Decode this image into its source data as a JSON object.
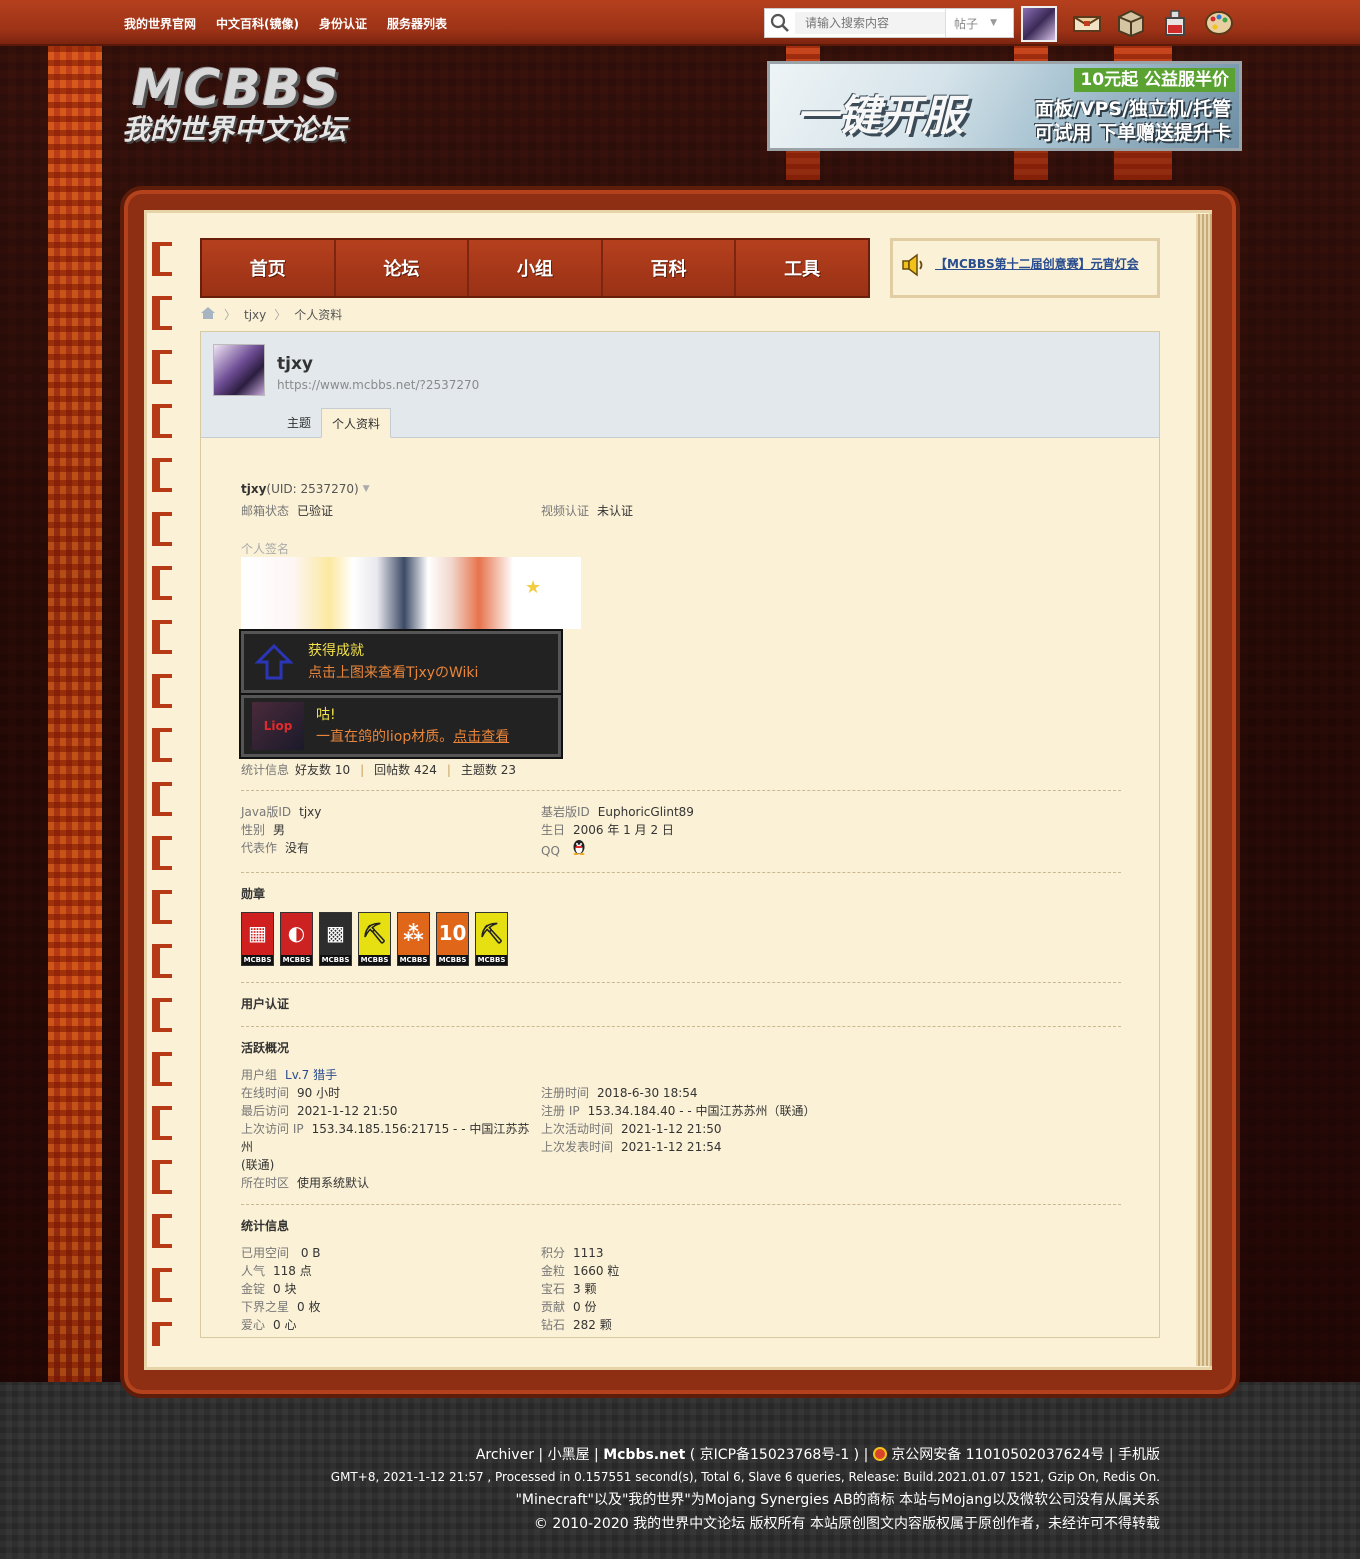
{
  "topbar": {
    "links": [
      "我的世界官网",
      "中文百科(镜像)",
      "身份认证",
      "服务器列表"
    ],
    "search_placeholder": "请输入搜索内容",
    "search_type": "帖子",
    "icons": [
      "avatar",
      "message-icon",
      "inventory-icon",
      "potion-icon",
      "palette-icon"
    ]
  },
  "header": {
    "logo_main": "MCBBS",
    "logo_sub": "我的世界中文论坛",
    "banner": {
      "tag": "10元起 公益服半价",
      "main": "一键开服",
      "line2": "面板/VPS/独立机/托管",
      "line3": "可试用 下单赠送提升卡"
    }
  },
  "nav": {
    "items": [
      "首页",
      "论坛",
      "小组",
      "百科",
      "工具"
    ],
    "notice": "【MCBBS第十二届创意赛】元宵灯会"
  },
  "breadcrumb": {
    "user": "tjxy",
    "page": "个人资料"
  },
  "profile": {
    "username": "tjxy",
    "url": "https://www.mcbbs.net/?2537270",
    "tabs": [
      "主题",
      "个人资料"
    ],
    "active_tab": "个人资料",
    "uid_line_name": "tjxy",
    "uid_line_uid": "(UID: 2537270)",
    "email_label": "邮箱状态",
    "email_value": "已验证",
    "video_label": "视频认证",
    "video_value": "未认证",
    "signature_label": "个人签名",
    "achievement1": {
      "title": "获得成就",
      "sub": "点击上图来查看TjxyのWiki"
    },
    "achievement2": {
      "title": "咕!",
      "sub": "一直在鸽的liop材质。",
      "link": "点击查看"
    },
    "stats_label": "统计信息",
    "stats": [
      "好友数 10",
      "回帖数 424",
      "主题数 23"
    ],
    "info_left": [
      {
        "label": "Java版ID",
        "value": "tjxy"
      },
      {
        "label": "性别",
        "value": "男"
      },
      {
        "label": "代表作",
        "value": "没有"
      }
    ],
    "info_right": [
      {
        "label": "基岩版ID",
        "value": "EuphoricGlint89"
      },
      {
        "label": "生日",
        "value": "2006 年 1 月 2 日"
      },
      {
        "label": "QQ",
        "value": ""
      }
    ],
    "medals_title": "勋章",
    "medals": [
      {
        "color": "#d01f1f",
        "glyph": "▦",
        "tag": "MCBBS"
      },
      {
        "color": "#cc2222",
        "glyph": "◐",
        "tag": "MCBBS"
      },
      {
        "color": "#2d2d2d",
        "glyph": "▩",
        "tag": "MCBBS"
      },
      {
        "color": "#e6e012",
        "glyph": "⛏",
        "tag": "MCBBS"
      },
      {
        "color": "#e0661a",
        "glyph": "⁂",
        "tag": "MCBBS"
      },
      {
        "color": "#e0661a",
        "glyph": "10",
        "tag": "MCBBS"
      },
      {
        "color": "#e6e012",
        "glyph": "⛏",
        "tag": "MCBBS"
      }
    ],
    "auth_title": "用户认证",
    "activity_title": "活跃概况",
    "usergroup_label": "用户组",
    "usergroup_value": "Lv.7 猎手",
    "activity_left": [
      {
        "label": "在线时间",
        "value": "90 小时"
      },
      {
        "label": "最后访问",
        "value": "2021-1-12 21:50"
      },
      {
        "label": "上次访问 IP",
        "value": "153.34.185.156:21715 - - 中国江苏苏州"
      },
      {
        "label": "",
        "value": "(联通)"
      },
      {
        "label": "所在时区",
        "value": "使用系统默认"
      }
    ],
    "activity_right": [
      {
        "label": "注册时间",
        "value": "2018-6-30 18:54"
      },
      {
        "label": "注册 IP",
        "value": "153.34.184.40 - - 中国江苏苏州（联通）"
      },
      {
        "label": "上次活动时间",
        "value": "2021-1-12 21:50"
      },
      {
        "label": "上次发表时间",
        "value": "2021-1-12 21:54"
      }
    ],
    "stats_title": "统计信息",
    "stats_left": [
      {
        "label": "已用空间",
        "value": " 0 B"
      },
      {
        "label": "人气",
        "value": "118 点"
      },
      {
        "label": "金锭",
        "value": "0 块"
      },
      {
        "label": "下界之星",
        "value": "0 枚"
      },
      {
        "label": "爱心",
        "value": "0 心"
      }
    ],
    "stats_right": [
      {
        "label": "积分",
        "value": "1113"
      },
      {
        "label": "金粒",
        "value": "1660 粒"
      },
      {
        "label": "宝石",
        "value": "3 颗"
      },
      {
        "label": "贡献",
        "value": "0 份"
      },
      {
        "label": "钻石",
        "value": "282 颗"
      }
    ]
  },
  "footer": {
    "l1_archiver": "Archiver",
    "l1_dark": "小黑屋",
    "l1_site": "Mcbbs.net",
    "l1_icp": "( 京ICP备15023768号-1 )",
    "l1_police": "京公网安备 11010502037624号",
    "l1_mobile": "手机版",
    "l2": "GMT+8, 2021-1-12 21:57 , Processed in 0.157551 second(s), Total 6, Slave 6 queries, Release: Build.2021.01.07 1521, Gzip On, Redis On.",
    "l3": "\"Minecraft\"以及\"我的世界\"为Mojang Synergies AB的商标 本站与Mojang以及微软公司没有从属关系",
    "l4": "© 2010-2020 我的世界中文论坛 版权所有 本站原创图文内容版权属于原创作者，未经许可不得转载"
  },
  "colors": {
    "topbar": "#a8361a",
    "nav": "#a8361a",
    "paper": "#fbf1d6",
    "link": "#2a4d8f",
    "achievement_title": "#f2e14a",
    "achievement_sub": "#e9853a"
  }
}
